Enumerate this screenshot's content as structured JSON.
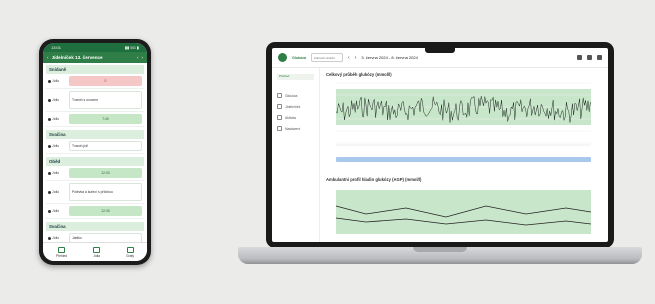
{
  "phone": {
    "status": {
      "time": "13:01",
      "right": "▮▮ 5G ▮"
    },
    "appbar": {
      "back": "‹",
      "title": "Jídelníček 13. července",
      "prev": "‹",
      "next": "›"
    },
    "sections": [
      {
        "header": "Snídaně",
        "meals": [
          {
            "label": "Jídlo",
            "value": "0",
            "style": "red"
          },
          {
            "label": "Jídlo",
            "value": "Tvaroh s ovocem",
            "style": "text tall"
          },
          {
            "label": "Jídlo",
            "value": "7:40",
            "style": "green"
          }
        ]
      },
      {
        "header": "Svačina",
        "meals": [
          {
            "label": "Jídlo",
            "value": "Tvaroh jídl",
            "style": "text"
          }
        ]
      },
      {
        "header": "Oběd",
        "meals": [
          {
            "label": "Jídlo",
            "value": "12:00",
            "style": "green"
          },
          {
            "label": "Jídlo",
            "value": "Polévka a kuřecí s přílohou",
            "style": "text tall"
          },
          {
            "label": "Jídlo",
            "value": "12:30",
            "style": "green"
          }
        ]
      },
      {
        "header": "Svačina",
        "meals": [
          {
            "label": "Jídlo",
            "value": "Jablko",
            "style": "text"
          }
        ]
      }
    ],
    "bottom_nav": [
      "Přehled",
      "Jídla",
      "Grafy"
    ]
  },
  "laptop": {
    "brand": "Glukóza",
    "period_select": "Zobrazit období",
    "prev": "‹",
    "next": "›",
    "date_range": "3. června 2024 - 8. června 2024",
    "sidebar_chip": "Přehled",
    "sidebar_items": [
      "Glukóza",
      "Jídelníček",
      "Aktivita",
      "Nastavení"
    ],
    "chart1_title": "Celkový průběh glukózy (mmol/l)",
    "chart2_title": "Ambulantní profil hladin glukózy (AGP) (mmol/l)"
  },
  "colors": {
    "accent": "#2f7d47",
    "band": "#c8e6c9",
    "nav_bar": "#a9c8ee"
  }
}
